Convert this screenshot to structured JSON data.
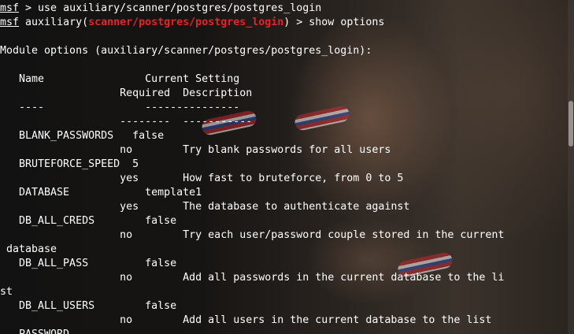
{
  "prompt": {
    "msf": "msf",
    "cmd1": " > use auxiliary/scanner/postgres/postgres_login",
    "aux_prefix": " auxiliary(",
    "module": "scanner/postgres/postgres_login",
    "cmd2_suffix": ") > show options"
  },
  "header": "Module options (auxiliary/scanner/postgres/postgres_login):",
  "columns": {
    "row1": "   Name                Current Setting",
    "row2": "                   Required  Description",
    "row3": "   ----                ---------------",
    "row4": "                   --------  -----------"
  },
  "options": [
    {
      "name_line": "   BLANK_PASSWORDS   false",
      "detail_line": "                   no        Try blank passwords for all users"
    },
    {
      "name_line": "   BRUTEFORCE_SPEED  5",
      "detail_line": "                   yes       How fast to bruteforce, from 0 to 5"
    },
    {
      "name_line": "   DATABASE            template1",
      "detail_line": "                   yes       The database to authenticate against"
    },
    {
      "name_line": "   DB_ALL_CREDS        false",
      "detail_line": "                   no        Try each user/password couple stored in the current",
      "wrap_line": " database"
    },
    {
      "name_line": "   DB_ALL_PASS         false",
      "detail_line": "                   no        Add all passwords in the current database to the li",
      "wrap_line": "st"
    },
    {
      "name_line": "   DB_ALL_USERS        false",
      "detail_line": "                   no        Add all users in the current database to the list"
    },
    {
      "name_line": "   PASSWORD"
    }
  ],
  "colors": {
    "text": "#ffffff",
    "module_red": "#e0262a"
  }
}
